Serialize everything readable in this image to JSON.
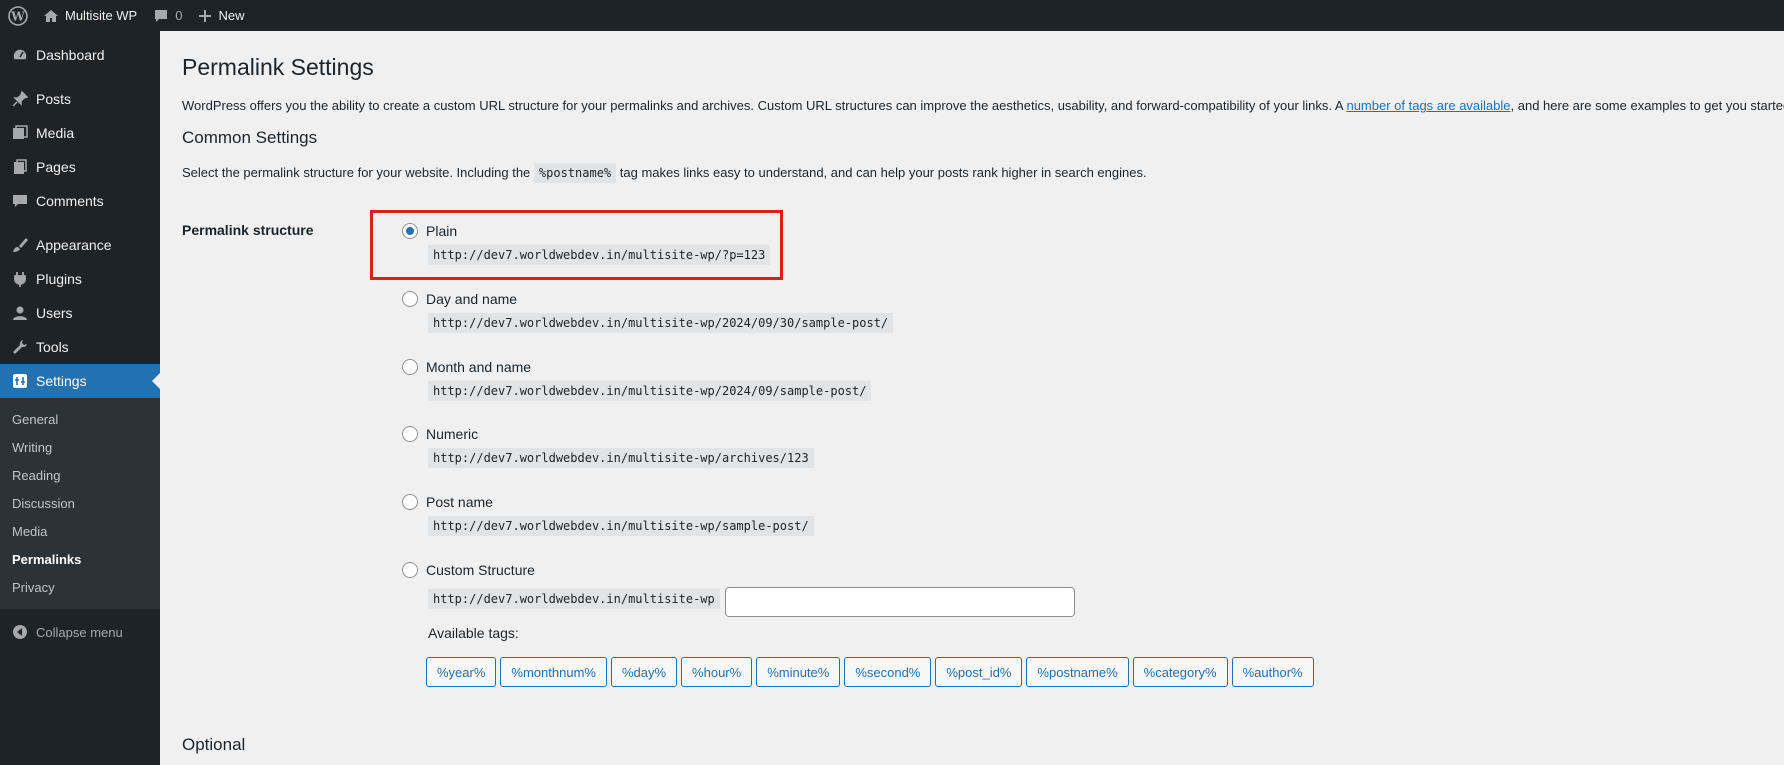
{
  "adminbar": {
    "site_name": "Multisite WP",
    "comments_count": "0",
    "new_label": "New"
  },
  "sidebar": {
    "items": [
      {
        "label": "Dashboard",
        "icon": "dashboard-icon"
      },
      {
        "label": "Posts",
        "icon": "pin-icon"
      },
      {
        "label": "Media",
        "icon": "media-icon"
      },
      {
        "label": "Pages",
        "icon": "pages-icon"
      },
      {
        "label": "Comments",
        "icon": "comment-icon"
      },
      {
        "label": "Appearance",
        "icon": "brush-icon"
      },
      {
        "label": "Plugins",
        "icon": "plug-icon"
      },
      {
        "label": "Users",
        "icon": "user-icon"
      },
      {
        "label": "Tools",
        "icon": "wrench-icon"
      },
      {
        "label": "Settings",
        "icon": "settings-icon"
      }
    ],
    "submenu": [
      "General",
      "Writing",
      "Reading",
      "Discussion",
      "Media",
      "Permalinks",
      "Privacy"
    ],
    "collapse_label": "Collapse menu"
  },
  "page": {
    "title": "Permalink Settings",
    "intro_before": "WordPress offers you the ability to create a custom URL structure for your permalinks and archives. Custom URL structures can improve the aesthetics, usability, and forward-compatibility of your links. A ",
    "intro_link": "number of tags are available",
    "intro_after": ", and here are some examples to get you started.",
    "common_heading": "Common Settings",
    "desc_before": "Select the permalink structure for your website. Including the ",
    "desc_code": "%postname%",
    "desc_after": " tag makes links easy to understand, and can help your posts rank higher in search engines.",
    "structure_label": "Permalink structure",
    "options": [
      {
        "label": "Plain",
        "url": "http://dev7.worldwebdev.in/multisite-wp/?p=123",
        "checked": true
      },
      {
        "label": "Day and name",
        "url": "http://dev7.worldwebdev.in/multisite-wp/2024/09/30/sample-post/",
        "checked": false
      },
      {
        "label": "Month and name",
        "url": "http://dev7.worldwebdev.in/multisite-wp/2024/09/sample-post/",
        "checked": false
      },
      {
        "label": "Numeric",
        "url": "http://dev7.worldwebdev.in/multisite-wp/archives/123",
        "checked": false
      },
      {
        "label": "Post name",
        "url": "http://dev7.worldwebdev.in/multisite-wp/sample-post/",
        "checked": false
      },
      {
        "label": "Custom Structure",
        "url": "http://dev7.worldwebdev.in/multisite-wp",
        "checked": false
      }
    ],
    "custom_value": "",
    "available_tags_label": "Available tags:",
    "tags": [
      "%year%",
      "%monthnum%",
      "%day%",
      "%hour%",
      "%minute%",
      "%second%",
      "%post_id%",
      "%postname%",
      "%category%",
      "%author%"
    ],
    "optional_heading": "Optional"
  },
  "colors": {
    "admin_bg": "#1d2327",
    "accent": "#2271b1",
    "highlight_box": "#e01b1b",
    "content_bg": "#f0f0f1"
  }
}
